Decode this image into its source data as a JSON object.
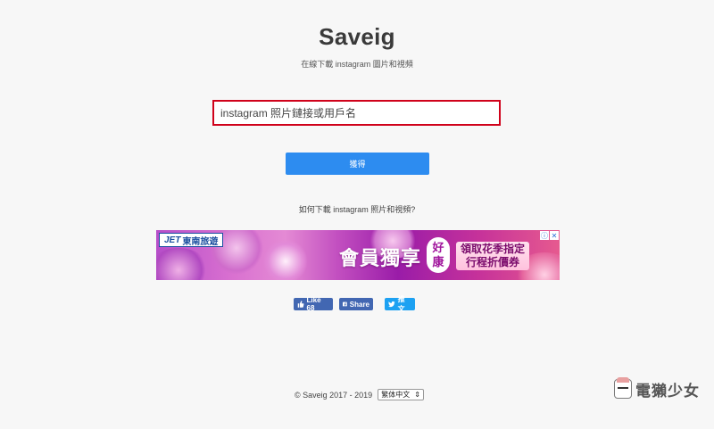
{
  "header": {
    "title": "Saveig",
    "subtitle": "在線下載 instagram 圖片和視頻"
  },
  "search": {
    "placeholder": "instagram 照片鏈接或用戶名",
    "value": ""
  },
  "submit": {
    "label": "獲得"
  },
  "howto": {
    "text": "如何下載 instagram 照片和視頻?"
  },
  "ad": {
    "brand_mark": "JET",
    "brand_name": "東南旅遊",
    "headline": "會員獨享",
    "badge_top": "好",
    "badge_bottom": "康",
    "promo_line1": "領取花季指定",
    "promo_line2": "行程折價券",
    "choices_info": "ⓘ",
    "choices_close": "✕"
  },
  "social": {
    "like_label": "Like 68",
    "share_label": "Share",
    "tweet_label": "推文"
  },
  "footer": {
    "copyright": "©  Saveig 2017 - 2019",
    "language": "繁体中文",
    "language_arrow": "⇕"
  },
  "watermark": {
    "text": "電獺少女"
  },
  "colors": {
    "accent": "#2d8cf0",
    "highlight_border": "#d0021b",
    "facebook": "#4267b2",
    "twitter": "#1da1f2"
  }
}
